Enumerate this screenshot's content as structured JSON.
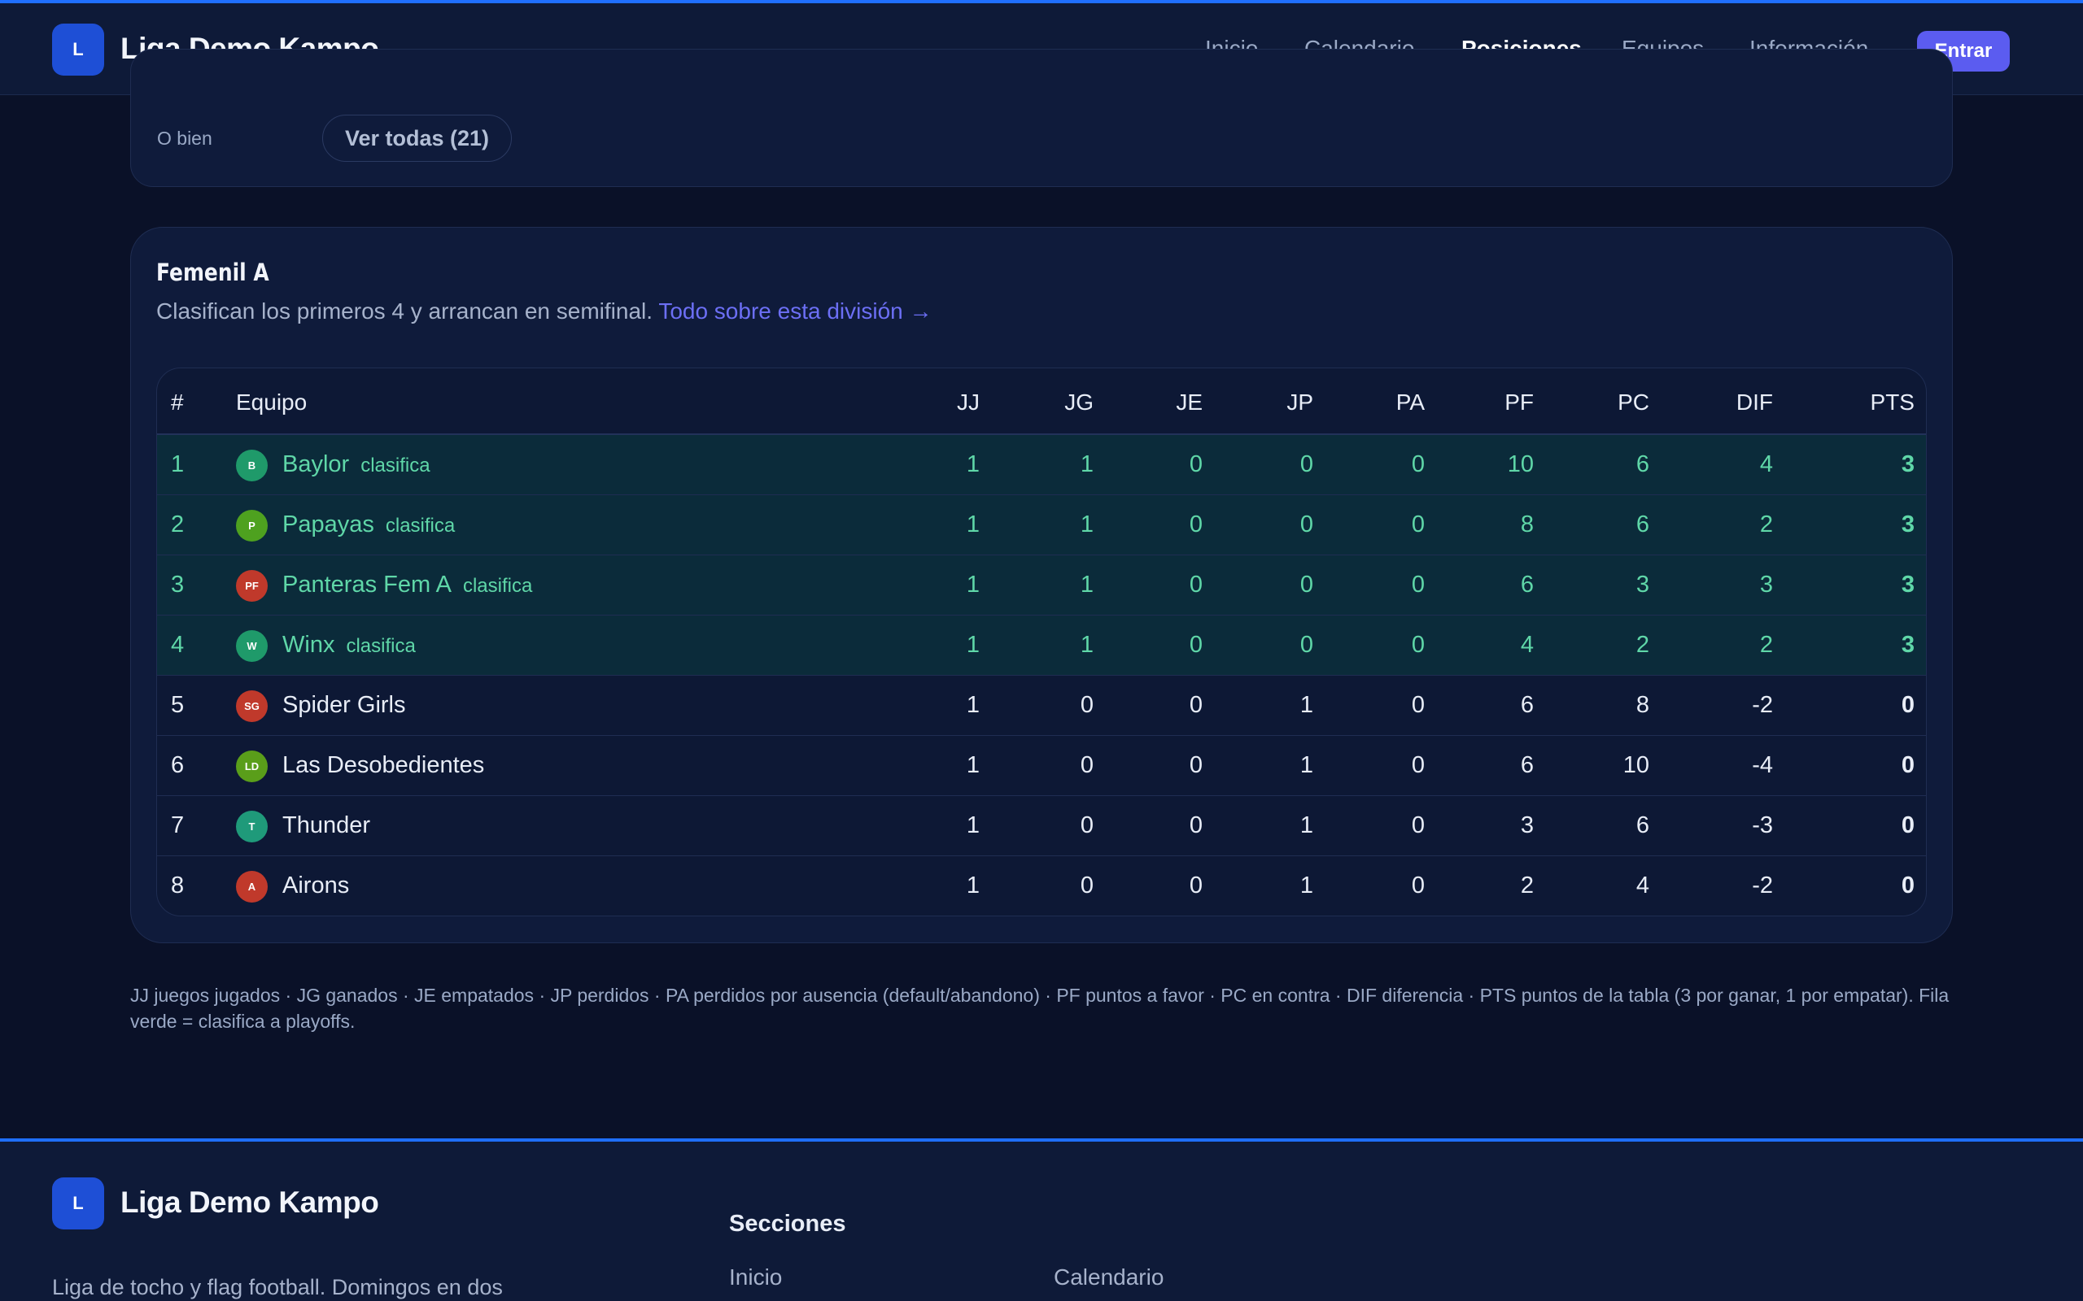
{
  "header": {
    "logo_letter": "L",
    "brand": "Liga Demo Kampo",
    "nav": [
      "Inicio",
      "Calendario",
      "Posiciones",
      "Equipos",
      "Información"
    ],
    "active_nav": "Posiciones",
    "login_label": "Entrar"
  },
  "filter": {
    "label": "O bien",
    "view_all": "Ver todas (21)"
  },
  "division": {
    "title": "Femenil A",
    "description": "Clasifican los primeros 4 y arrancan en semifinal.",
    "link_text": "Todo sobre esta división →",
    "columns": [
      "#",
      "Equipo",
      "JJ",
      "JG",
      "JE",
      "JP",
      "PA",
      "PF",
      "PC",
      "DIF",
      "PTS"
    ],
    "qualify_label": "clasifica",
    "rows": [
      {
        "pos": "1",
        "initials": "B",
        "badge_color": "#1f9a6a",
        "team": "Baylor",
        "qualifies": true,
        "jj": "1",
        "jg": "1",
        "je": "0",
        "jp": "0",
        "pa": "0",
        "pf": "10",
        "pc": "6",
        "dif": "4",
        "pts": "3"
      },
      {
        "pos": "2",
        "initials": "P",
        "badge_color": "#4ea11f",
        "team": "Papayas",
        "qualifies": true,
        "jj": "1",
        "jg": "1",
        "je": "0",
        "jp": "0",
        "pa": "0",
        "pf": "8",
        "pc": "6",
        "dif": "2",
        "pts": "3"
      },
      {
        "pos": "3",
        "initials": "PF",
        "badge_color": "#c0392b",
        "team": "Panteras Fem A",
        "qualifies": true,
        "jj": "1",
        "jg": "1",
        "je": "0",
        "jp": "0",
        "pa": "0",
        "pf": "6",
        "pc": "3",
        "dif": "3",
        "pts": "3"
      },
      {
        "pos": "4",
        "initials": "W",
        "badge_color": "#1f9a6a",
        "team": "Winx",
        "qualifies": true,
        "jj": "1",
        "jg": "1",
        "je": "0",
        "jp": "0",
        "pa": "0",
        "pf": "4",
        "pc": "2",
        "dif": "2",
        "pts": "3"
      },
      {
        "pos": "5",
        "initials": "SG",
        "badge_color": "#c0392b",
        "team": "Spider Girls",
        "qualifies": false,
        "jj": "1",
        "jg": "0",
        "je": "0",
        "jp": "1",
        "pa": "0",
        "pf": "6",
        "pc": "8",
        "dif": "-2",
        "pts": "0"
      },
      {
        "pos": "6",
        "initials": "LD",
        "badge_color": "#5a9e1a",
        "team": "Las Desobedientes",
        "qualifies": false,
        "jj": "1",
        "jg": "0",
        "je": "0",
        "jp": "1",
        "pa": "0",
        "pf": "6",
        "pc": "10",
        "dif": "-4",
        "pts": "0"
      },
      {
        "pos": "7",
        "initials": "T",
        "badge_color": "#1f9a7a",
        "team": "Thunder",
        "qualifies": false,
        "jj": "1",
        "jg": "0",
        "je": "0",
        "jp": "1",
        "pa": "0",
        "pf": "3",
        "pc": "6",
        "dif": "-3",
        "pts": "0"
      },
      {
        "pos": "8",
        "initials": "A",
        "badge_color": "#c0392b",
        "team": "Airons",
        "qualifies": false,
        "jj": "1",
        "jg": "0",
        "je": "0",
        "jp": "1",
        "pa": "0",
        "pf": "2",
        "pc": "4",
        "dif": "-2",
        "pts": "0"
      }
    ]
  },
  "legend": "JJ juegos jugados · JG ganados · JE empatados · JP perdidos · PA perdidos por ausencia (default/abandono) · PF puntos a favor · PC en contra · DIF diferencia · PTS puntos de la tabla (3 por ganar, 1 por empatar). Fila verde = clasifica a playoffs.",
  "footer": {
    "logo_letter": "L",
    "brand": "Liga Demo Kampo",
    "description": "Liga de tocho y flag football. Domingos en dos",
    "sections_title": "Secciones",
    "links": [
      "Inicio",
      "Calendario"
    ]
  },
  "colors": {
    "accent": "#1f6fff",
    "button": "#5b5cf0",
    "qualify_text": "#5fd7a8",
    "qualify_row": "#0b2b3a"
  }
}
